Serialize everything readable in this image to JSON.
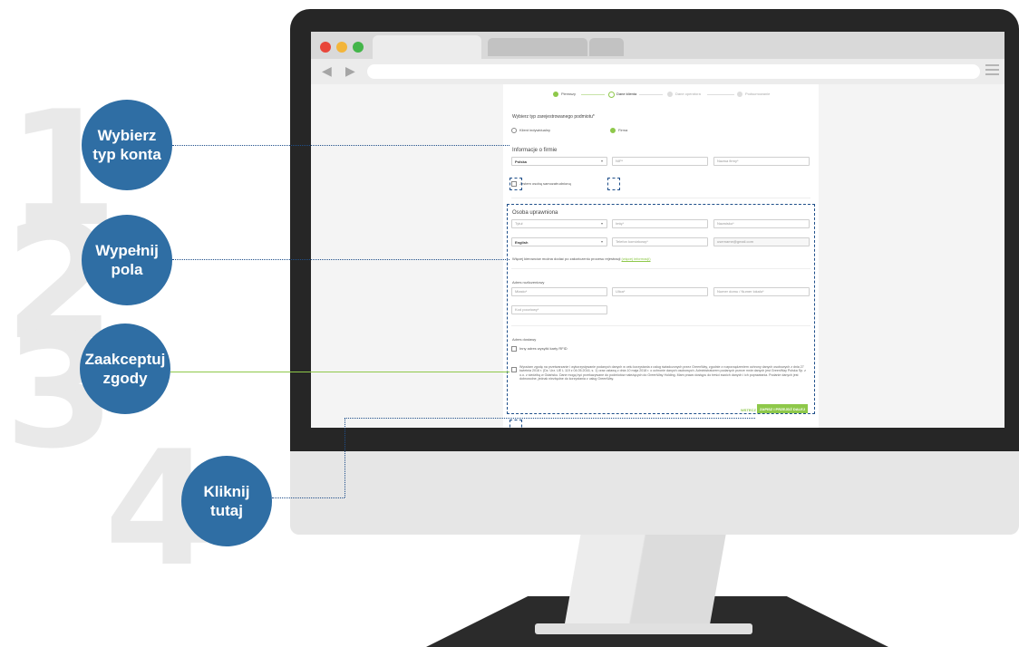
{
  "steps": [
    {
      "number": "1",
      "label": "Wybierz\ntyp konta"
    },
    {
      "number": "2",
      "label": "Wypełnij\npola"
    },
    {
      "number": "3",
      "label": "Zaakceptuj\nzgody"
    },
    {
      "number": "4",
      "label": "Kliknij\ntutaj"
    }
  ],
  "colors": {
    "bubble": "#2f6ea4",
    "accent_green": "#8ec84a",
    "connector": "#1f4f8a"
  },
  "stepper": {
    "items": [
      "Pierwszy",
      "Dane klienta",
      "Dane operatora",
      "Podsumowanie"
    ]
  },
  "form": {
    "account_type_title": "Wybierz typ zarejestrowanego podmiotu*",
    "account_options": [
      "Klient indywidualny",
      "Firma"
    ],
    "company_section": {
      "title": "Informacje o firmie",
      "country_label": "Kraj",
      "country_value": "Polska",
      "nip_placeholder": "NIP*",
      "company_name_placeholder": "Nazwa firmy*",
      "self_employed_label": "Jestem osobą samozatrudnioną"
    },
    "authorized_section": {
      "title": "Osoba uprawniona",
      "title_placeholder": "Tytuł",
      "first_name_placeholder": "Imię*",
      "last_name_placeholder": "Nazwisko*",
      "language_label": "Język komunikacji*",
      "language_value": "English",
      "phone_placeholder": "Telefon komórkowy*",
      "email_label": "Email",
      "email_value": "username@gmail.com",
      "note": "Więcej kierowców można dodać po zakończeniu procesu rejestracji",
      "note_link": "(więcej informacji)"
    },
    "address_section": {
      "title": "Adres rozliczeniowy",
      "street_placeholder": "Miasto*",
      "city_placeholder": "Ulica*",
      "house_placeholder": "Numer domu / Numer lokalu*",
      "postal_placeholder": "Kod pocztowy*"
    },
    "delivery_section": {
      "title": "Adres dostawy",
      "other_address_label": "Inny adres wysyłki karty RFID"
    },
    "consent_text": "Wyrażam zgodę na przetwarzanie i wykorzystywanie podanych danych w celu korzystania z usług świadczonych przez GreenWay, zgodnie z rozporządzeniem ochrony danych osobowych z dnia 27 kwietnia 2016 r. (Dz. Urz. UE L 119 z 04.05.2016, s. 1) oraz ustawą z dnia 10 maja 2018 r. o ochronie danych osobowych. Administratorem podanych przeze mnie danych jest GreenWay Polska Sp. z o.o. z siedzibą w Gdańsku. Dane mogą być przekazywane do podmiotów należących do GreenWay Holding. Mam prawo dostępu do treści swoich danych i ich poprawiania. Podanie danych jest dobrowolne, jednak niezbędne do korzystania z usług GreenWay.",
    "cancel_label": "WSTECZ",
    "submit_label": "ZAPISZ I PRZEJDŹ DALEJ"
  }
}
